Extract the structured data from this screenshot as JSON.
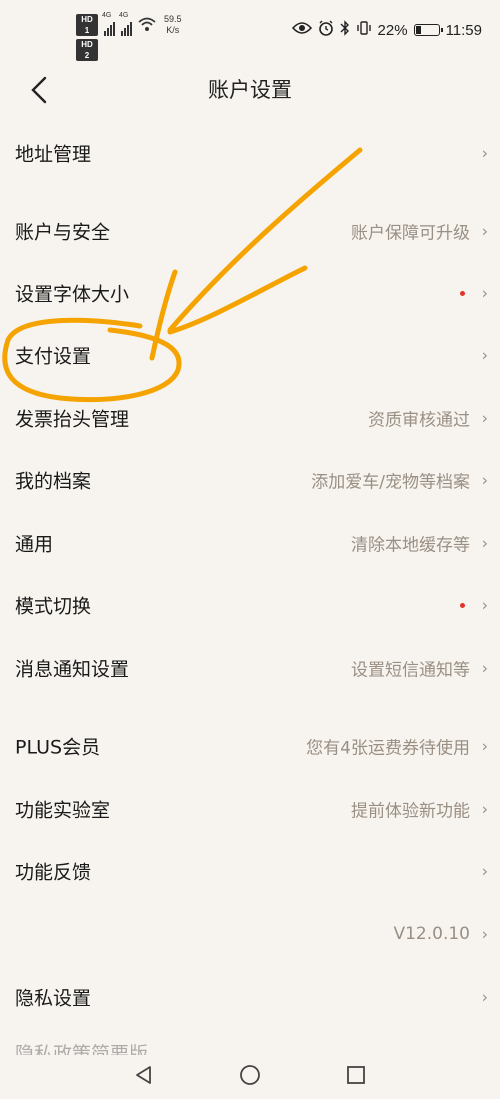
{
  "status_bar": {
    "hd_1": "HD 1",
    "hd_2": "HD 2",
    "net_1": "4G",
    "net_2": "4G",
    "speed_value": "59.5",
    "speed_unit": "K/s",
    "battery": "22%",
    "time": "11:59"
  },
  "header": {
    "title": "账户设置"
  },
  "rows": [
    {
      "label": "地址管理",
      "value": ""
    },
    {
      "label": "账户与安全",
      "value": "账户保障可升级"
    },
    {
      "label": "设置字体大小",
      "value": "",
      "dot": true
    },
    {
      "label": "支付设置",
      "value": ""
    },
    {
      "label": "发票抬头管理",
      "value": "资质审核通过"
    },
    {
      "label": "我的档案",
      "value": "添加爱车/宠物等档案"
    },
    {
      "label": "通用",
      "value": "清除本地缓存等"
    },
    {
      "label": "模式切换",
      "value": "",
      "dot": true
    },
    {
      "label": "消息通知设置",
      "value": "设置短信通知等"
    },
    {
      "label": "PLUS会员",
      "value": "您有4张运费券待使用"
    },
    {
      "label": "功能实验室",
      "value": "提前体验新功能"
    },
    {
      "label": "功能反馈",
      "value": ""
    },
    {
      "label": "",
      "value": "V12.0.10"
    },
    {
      "label": "隐私设置",
      "value": ""
    },
    {
      "label": "隐私政策简要版",
      "value": ""
    }
  ],
  "chevron": "›",
  "colors": {
    "background": "#f7f4ef",
    "value_text": "#9a8f84",
    "red_dot": "#e3322d",
    "annotation": "#f5a300"
  }
}
